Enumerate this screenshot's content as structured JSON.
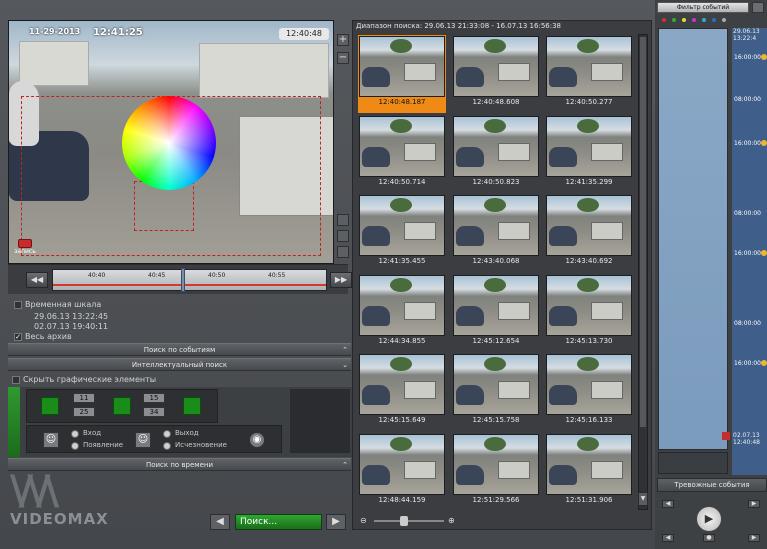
{
  "video": {
    "osd_date": "11-29-2013",
    "osd_time": "12:41:25",
    "time_chip": "12:40:48",
    "record_label": "запись",
    "zoom_in": "+",
    "zoom_out": "−"
  },
  "timeline": {
    "ticks": [
      "40:40",
      "40:45",
      "40:50",
      "40:55"
    ],
    "back_label": "◀◀",
    "forward_label": "▶▶"
  },
  "timescale": {
    "label": "Временная шкала",
    "start": "29.06.13 13:22:45",
    "end": "02.07.13 19:40:11",
    "whole_archive": "Весь архив"
  },
  "sections": {
    "event_search": "Поиск по событиям",
    "smart_search": "Интеллектуальный поиск",
    "time_search": "Поиск по времени"
  },
  "toolbox": {
    "hide_graphics": "Скрыть графические элементы",
    "spin_values": [
      "11",
      "25",
      "15",
      "34"
    ],
    "entry_label": "Вход",
    "exit_label": "Выход",
    "appear_label": "Появление",
    "disappear_label": "Исчезновение"
  },
  "logo": {
    "text": "VIDEOMAX"
  },
  "search": {
    "button_label": "Поиск...",
    "prev": "◀",
    "next": "▶"
  },
  "results": {
    "range": "Диапазон поиска:  29.06.13 21:33:08 - 16.07.13 16:56:38",
    "timestamps": [
      "12:40:48.187",
      "12:40:48.608",
      "12:40:50.277",
      "12:40:50.714",
      "12:40:50.823",
      "12:41:35.299",
      "12:41:35.455",
      "12:43:40.068",
      "12:43:40.692",
      "12:44:34.855",
      "12:45:12.654",
      "12:45:13.730",
      "12:45:15.649",
      "12:45:15.758",
      "12:45:16.133",
      "12:48:44.159",
      "12:51:29.566",
      "12:51:31.906"
    ],
    "selected_index": 0
  },
  "calendar": {
    "filter_label": "Фильтр событий",
    "date_top": "29.06.13",
    "time_top": "13:22:4",
    "hours": [
      "16:00:00",
      "08:00:00",
      "16:00:00",
      "08:00:00",
      "16:00:00",
      "08:00:00",
      "16:00:00"
    ],
    "date_bottom": "02.07.13",
    "time_bottom": "12:40:48",
    "alarm_label": "Тревожные события",
    "play": "▶"
  },
  "colors": {
    "accent_selected": "#ef8a17",
    "search_button": "#2fa72f",
    "timeline_red": "#d43a2c"
  }
}
